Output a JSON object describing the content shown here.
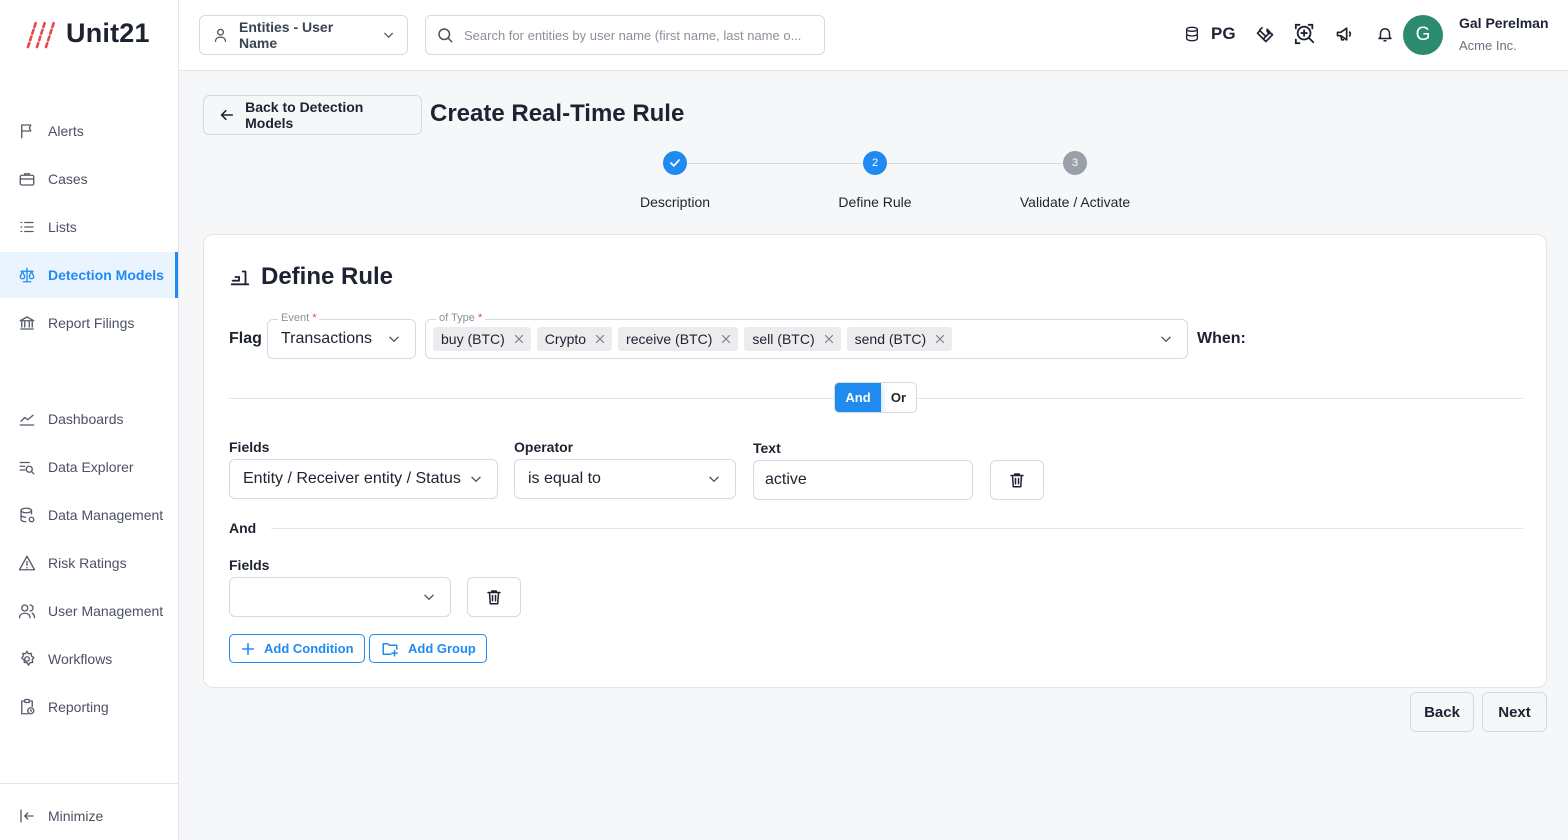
{
  "app": {
    "logo_text": "Unit21"
  },
  "sidebar": {
    "items": [
      {
        "label": "Alerts",
        "icon": "flag-icon"
      },
      {
        "label": "Cases",
        "icon": "briefcase-icon"
      },
      {
        "label": "Lists",
        "icon": "list-icon"
      },
      {
        "label": "Detection Models",
        "icon": "scale-icon",
        "active": true
      },
      {
        "label": "Report Filings",
        "icon": "bank-icon"
      },
      {
        "label": "Dashboards",
        "icon": "chart-line-icon"
      },
      {
        "label": "Data Explorer",
        "icon": "data-search-icon"
      },
      {
        "label": "Data Management",
        "icon": "database-icon"
      },
      {
        "label": "Risk Ratings",
        "icon": "warning-icon"
      },
      {
        "label": "User Management",
        "icon": "users-icon"
      },
      {
        "label": "Workflows",
        "icon": "gear-icon"
      },
      {
        "label": "Reporting",
        "icon": "report-icon"
      }
    ],
    "minimize_label": "Minimize"
  },
  "topbar": {
    "entity_select": "Entities - User Name",
    "search_placeholder": "Search for entities by user name (first name, last name o...",
    "org_code": "PG",
    "user_name": "Gal Perelman",
    "user_org": "Acme Inc.",
    "avatar_initial": "G"
  },
  "header": {
    "back_label": "Back to Detection Models",
    "title": "Create Real-Time Rule"
  },
  "stepper": {
    "steps": [
      {
        "label": "Description",
        "number": "1",
        "state": "done"
      },
      {
        "label": "Define Rule",
        "number": "2",
        "state": "current"
      },
      {
        "label": "Validate / Activate",
        "number": "3",
        "state": "upcoming"
      }
    ]
  },
  "define_rule": {
    "title": "Define Rule",
    "flag_label": "Flag",
    "event_label": "Event",
    "event_value": "Transactions",
    "type_label": "of Type",
    "type_chips": [
      "buy (BTC)",
      "Crypto",
      "receive (BTC)",
      "sell (BTC)",
      "send (BTC)"
    ],
    "when_label": "When:",
    "toggle_and": "And",
    "toggle_or": "Or",
    "condition1": {
      "fields_label": "Fields",
      "fields_value": "Entity / Receiver entity / Status",
      "operator_label": "Operator",
      "operator_value": "is equal to",
      "text_label": "Text",
      "text_value": "active"
    },
    "connector_label": "And",
    "condition2": {
      "fields_label": "Fields",
      "fields_value": ""
    },
    "add_condition_label": "Add Condition",
    "add_group_label": "Add Group"
  },
  "footer": {
    "back_label": "Back",
    "next_label": "Next"
  },
  "colors": {
    "accent": "#1f8bf0",
    "avatar": "#2b8a6f",
    "logo_mark": "#e5484d",
    "step_upcoming": "#9aa0aa"
  }
}
